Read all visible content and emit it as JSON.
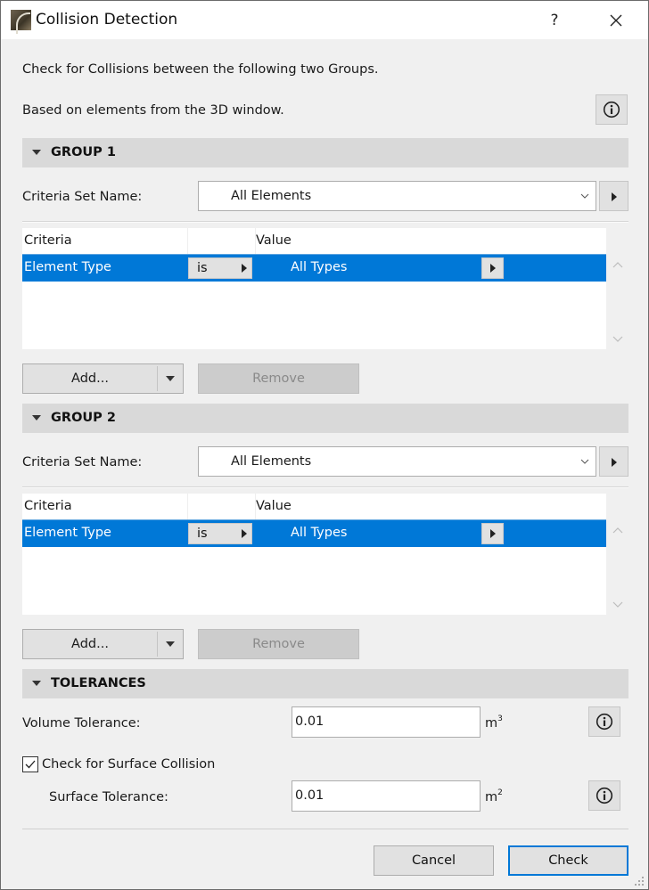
{
  "window": {
    "title": "Collision Detection",
    "help_label": "?",
    "icons": {
      "app": "archicad-app-icon",
      "help": "help-icon",
      "close": "close-icon"
    }
  },
  "intro": {
    "line1": "Check for Collisions between the following two Groups.",
    "line2": "Based on elements from the 3D window."
  },
  "groups": [
    {
      "title": "GROUP 1",
      "criteria_set_label": "Criteria Set Name:",
      "criteria_set_value": "All Elements",
      "table": {
        "columns": [
          "Criteria",
          "",
          "Value"
        ],
        "rows": [
          {
            "criteria": "Element Type",
            "operator": "is",
            "value": "All Types",
            "selected": true
          }
        ]
      },
      "add_label": "Add...",
      "remove_label": "Remove"
    },
    {
      "title": "GROUP 2",
      "criteria_set_label": "Criteria Set Name:",
      "criteria_set_value": "All Elements",
      "table": {
        "columns": [
          "Criteria",
          "",
          "Value"
        ],
        "rows": [
          {
            "criteria": "Element Type",
            "operator": "is",
            "value": "All Types",
            "selected": true
          }
        ]
      },
      "add_label": "Add...",
      "remove_label": "Remove"
    }
  ],
  "tolerances": {
    "title": "TOLERANCES",
    "volume_label": "Volume Tolerance:",
    "volume_value": "0.01",
    "volume_unit": "m",
    "volume_unit_exp": "3",
    "surface_check_label": "Check for Surface Collision",
    "surface_check_checked": true,
    "surface_label": "Surface Tolerance:",
    "surface_value": "0.01",
    "surface_unit": "m",
    "surface_unit_exp": "2"
  },
  "footer": {
    "cancel_label": "Cancel",
    "check_label": "Check"
  },
  "colors": {
    "selection": "#0078d7",
    "section_header": "#d9d9d9",
    "dialog_bg": "#f0f0f0"
  }
}
